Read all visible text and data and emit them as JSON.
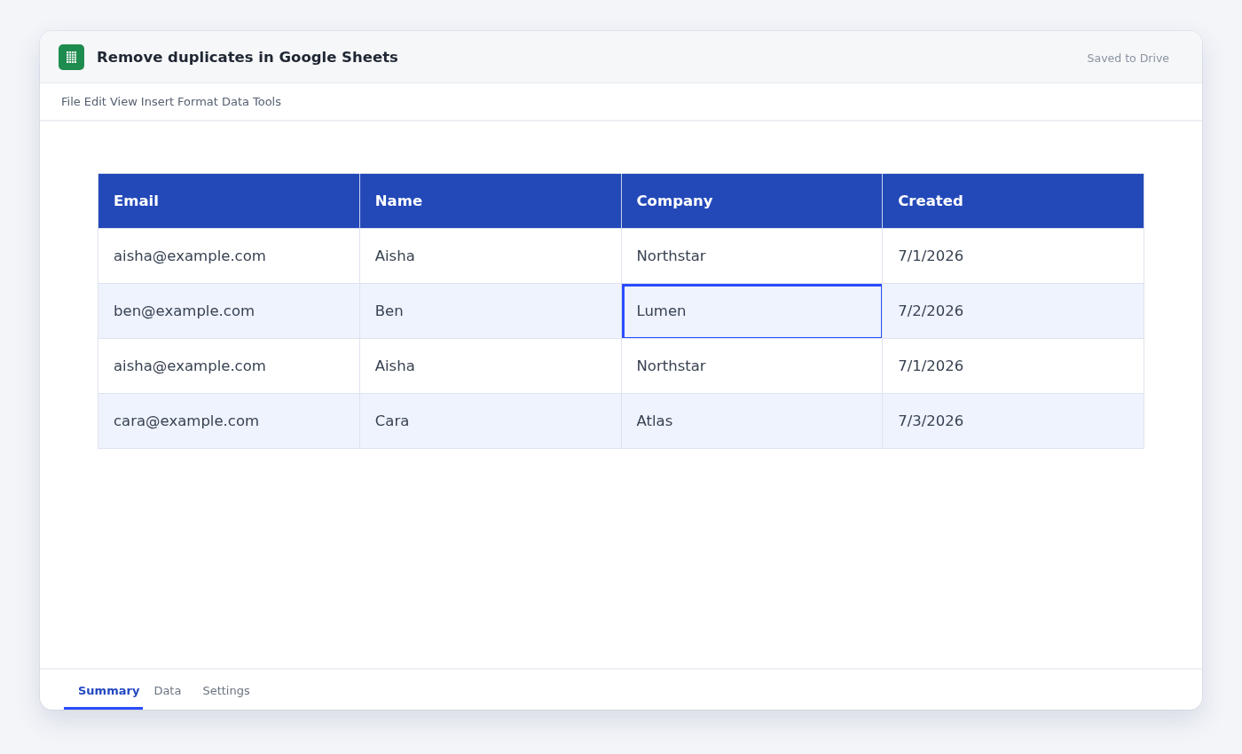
{
  "window": {
    "title": "Remove duplicates in Google Sheets",
    "status": "Saved to Drive"
  },
  "menu": [
    "File",
    "Edit",
    "View",
    "Insert",
    "Format",
    "Data",
    "Tools"
  ],
  "table": {
    "columns": [
      "Email",
      "Name",
      "Company",
      "Created"
    ],
    "rows": [
      {
        "cells": [
          {
            "text": "aisha@example.com",
            "selected": false
          },
          {
            "text": "Aisha",
            "selected": false
          },
          {
            "text": "Northstar",
            "selected": false
          },
          {
            "text": "7/1/2026",
            "selected": false
          }
        ]
      },
      {
        "cells": [
          {
            "text": "ben@example.com",
            "selected": false
          },
          {
            "text": "Ben",
            "selected": false
          },
          {
            "text": "Lumen",
            "selected": true
          },
          {
            "text": "7/2/2026",
            "selected": false
          }
        ]
      },
      {
        "cells": [
          {
            "text": "aisha@example.com",
            "selected": false
          },
          {
            "text": "Aisha",
            "selected": false
          },
          {
            "text": "Northstar",
            "selected": false
          },
          {
            "text": "7/1/2026",
            "selected": false
          }
        ]
      },
      {
        "cells": [
          {
            "text": "cara@example.com",
            "selected": false
          },
          {
            "text": "Cara",
            "selected": false
          },
          {
            "text": "Atlas",
            "selected": false
          },
          {
            "text": "7/3/2026",
            "selected": false
          }
        ]
      }
    ]
  },
  "tabs": [
    {
      "label": "Summary",
      "selected": true
    },
    {
      "label": "Data",
      "selected": false
    },
    {
      "label": "Settings",
      "selected": false
    }
  ]
}
